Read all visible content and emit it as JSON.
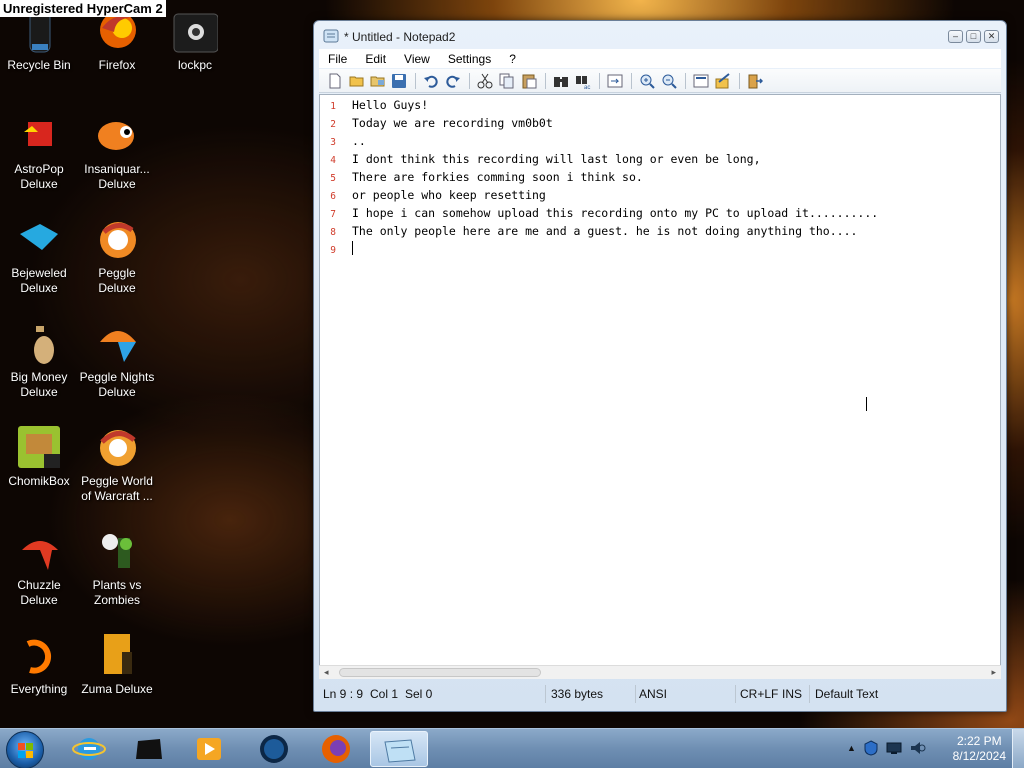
{
  "watermark": "Unregistered HyperCam 2",
  "desktop": {
    "icons": [
      {
        "label": "Recycle Bin"
      },
      {
        "label": "Firefox"
      },
      {
        "label": "lockpc"
      },
      {
        "label": "AstroPop Deluxe"
      },
      {
        "label": "Insaniquar... Deluxe"
      },
      {
        "label": "Bejeweled Deluxe"
      },
      {
        "label": "Peggle Deluxe"
      },
      {
        "label": "Big Money Deluxe"
      },
      {
        "label": "Peggle Nights Deluxe"
      },
      {
        "label": "ChomikBox"
      },
      {
        "label": "Peggle World of Warcraft ..."
      },
      {
        "label": "Chuzzle Deluxe"
      },
      {
        "label": "Plants vs Zombies"
      },
      {
        "label": "Everything"
      },
      {
        "label": "Zuma Deluxe"
      }
    ]
  },
  "window": {
    "title": "* Untitled - Notepad2",
    "minimize_label": "–",
    "maximize_label": "□",
    "close_label": "✕"
  },
  "menu": {
    "file": "File",
    "edit": "Edit",
    "view": "View",
    "settings": "Settings",
    "help": "?"
  },
  "editor": {
    "lines": [
      {
        "num": "1",
        "text": "Hello Guys!"
      },
      {
        "num": "2",
        "text": "Today we are recording vm0b0t"
      },
      {
        "num": "3",
        "text": ".."
      },
      {
        "num": "4",
        "text": "I dont think this recording will last long or even be long,"
      },
      {
        "num": "5",
        "text": "There are forkies comming soon i think so."
      },
      {
        "num": "6",
        "text": "or people who keep resetting"
      },
      {
        "num": "7",
        "text": "I hope i can somehow upload this recording onto my PC to upload it.........."
      },
      {
        "num": "8",
        "text": "The only people here are me and a guest. he is not doing anything tho...."
      },
      {
        "num": "9",
        "text": ""
      }
    ]
  },
  "status": {
    "position": "Ln 9 : 9",
    "col": "Col 1",
    "sel": "Sel 0",
    "size": "336 bytes",
    "encoding": "ANSI",
    "eol": "CR+LF",
    "mode": "INS",
    "scheme": "Default Text"
  },
  "taskbar": {
    "time": "2:22 PM",
    "date": "8/12/2024"
  },
  "colors": {
    "line_number": "#d03b2a",
    "taskbar": "#6f8fb3"
  }
}
